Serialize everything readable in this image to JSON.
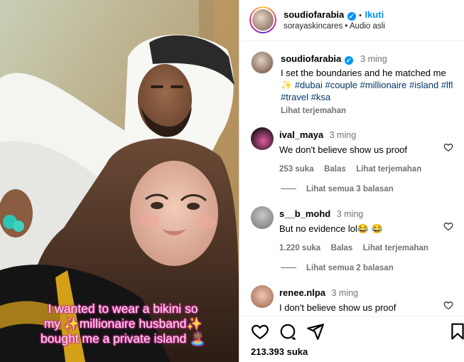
{
  "post": {
    "account": "soudiofarabia",
    "follow_label": "Ikuti",
    "subline_user": "sorayaskincares",
    "subline_separator": "•",
    "audio": "Audio asli",
    "caption_time": "3 ming",
    "caption_text": "I set the boundaries and he matched me ✨ ",
    "hashtags": "#dubai #couple #millionaire #island #lfl #travel #ksa",
    "see_translation": "Lihat terjemahan",
    "likes": "213.393 suka",
    "overlay_lines": [
      "I wanted to wear a bikini so",
      "my ✨millionaire husband✨",
      "bought me a private island 🏝️"
    ]
  },
  "comments": [
    {
      "user": "ival_maya",
      "time": "3 ming",
      "text": "We don't believe show us proof",
      "likes": "253 suka",
      "reply": "Balas",
      "translate": "Lihat terjemahan",
      "view_replies": "Lihat semua 3 balasan"
    },
    {
      "user": "s__b_mohd",
      "time": "3 ming",
      "text": "But no evidence lol😂 😂",
      "likes": "1.220 suka",
      "reply": "Balas",
      "translate": "Lihat terjemahan",
      "view_replies": "Lihat semua 2 balasan"
    },
    {
      "user": "renee.nlpa",
      "time": "3 ming",
      "text": "I don't believe show us proof"
    }
  ],
  "colors": {
    "accent_blue": "#0095f6",
    "hashtag": "#00376b",
    "muted": "#737373"
  },
  "icons": [
    "heart-icon",
    "comment-icon",
    "share-icon",
    "bookmark-icon",
    "verified-badge-icon"
  ]
}
